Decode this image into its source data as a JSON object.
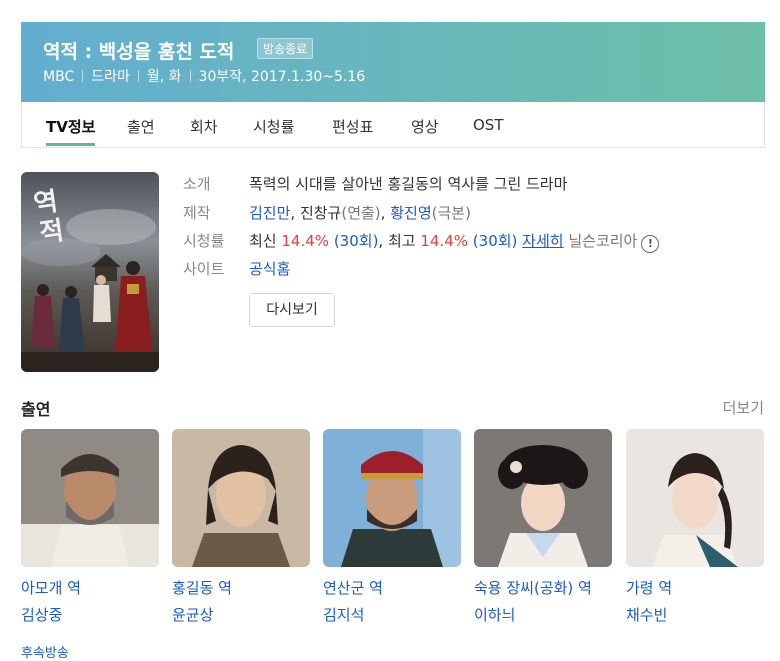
{
  "header": {
    "title": "역적 : 백성을 훔친 도적",
    "badge": "방송종료",
    "network": "MBC",
    "genre": "드라마",
    "days": "월, 화",
    "episodes_dates": "30부작, 2017.1.30~5.16"
  },
  "tabs": [
    "TV정보",
    "출연",
    "회차",
    "시청률",
    "편성표",
    "영상",
    "OST"
  ],
  "info": {
    "intro_label": "소개",
    "intro": "폭력의 시대를 살아낸 홍길동의 역사를 그린 드라마",
    "production_label": "제작",
    "director1": "김진만",
    "director2": "진창규",
    "director_role": "(연출)",
    "writer": "황진영",
    "writer_role": "(극본)",
    "ratings_label": "시청률",
    "latest_prefix": "최신",
    "latest_value": "14.4%",
    "latest_ep": "(30회)",
    "best_prefix": "최고",
    "best_value": "14.4%",
    "best_ep": "(30회)",
    "detail_link": "자세히",
    "source": "닐슨코리아",
    "site_label": "사이트",
    "site_link": "공식홈",
    "replay_button": "다시보기"
  },
  "cast_section": {
    "title": "출연",
    "more": "더보기",
    "members": [
      {
        "role": "아모개 역",
        "name": "김상중"
      },
      {
        "role": "홍길동 역",
        "name": "윤균상"
      },
      {
        "role": "연산군 역",
        "name": "김지석"
      },
      {
        "role": "숙용 장씨(공화) 역",
        "name": "이하늬"
      },
      {
        "role": "가령 역",
        "name": "채수빈"
      }
    ]
  },
  "footer_partial": "후속방송"
}
